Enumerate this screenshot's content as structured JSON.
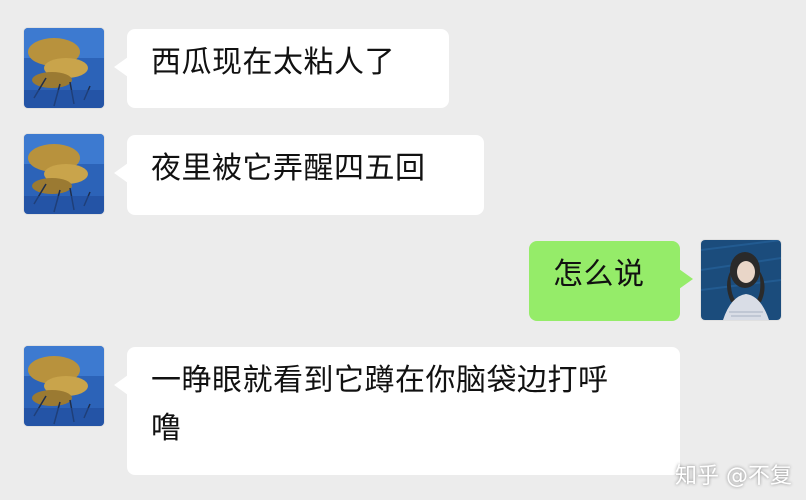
{
  "messages": [
    {
      "side": "left",
      "text": "西瓜现在太粘人了",
      "avatar": "lake-landscape-avatar"
    },
    {
      "side": "left",
      "text": "夜里被它弄醒四五回",
      "avatar": "lake-landscape-avatar"
    },
    {
      "side": "right",
      "text": "怎么说",
      "avatar": "girl-portrait-avatar"
    },
    {
      "side": "left",
      "text": "一睁眼就看到它蹲在你脑袋边打呼\n噜",
      "avatar": "lake-landscape-avatar"
    }
  ],
  "watermark": "知乎 @不复",
  "colors": {
    "background": "#ececec",
    "left_bubble": "#ffffff",
    "right_bubble": "#95ec69"
  }
}
